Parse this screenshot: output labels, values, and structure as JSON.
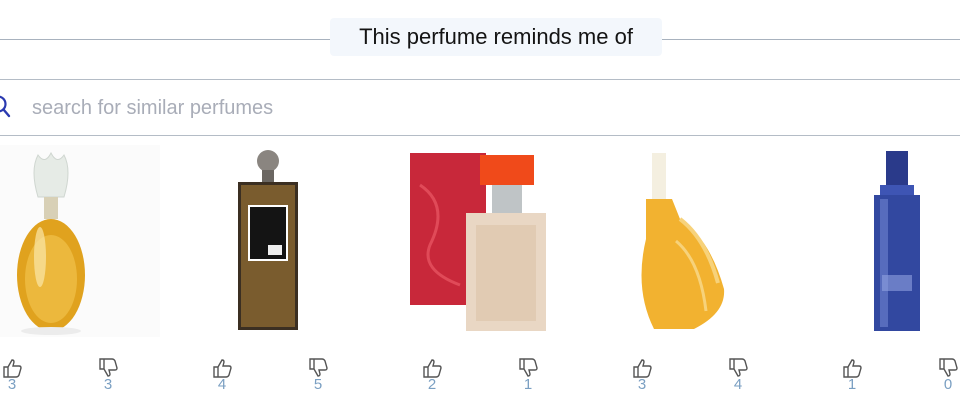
{
  "header": {
    "title": "This perfume reminds me of"
  },
  "search": {
    "placeholder": "search for similar perfumes",
    "value": ""
  },
  "colors": {
    "accent": "#2b3ab0",
    "count": "#7a9fc2",
    "divider": "#b4bcc6"
  },
  "perfumes": [
    {
      "image_icon": "perfume-bottle-floral",
      "upvotes": "3",
      "downvotes": "3"
    },
    {
      "image_icon": "perfume-bottle-black-label",
      "upvotes": "4",
      "downvotes": "5"
    },
    {
      "image_icon": "perfume-bottle-red-box",
      "upvotes": "2",
      "downvotes": "1"
    },
    {
      "image_icon": "perfume-bottle-shell",
      "upvotes": "3",
      "downvotes": "4"
    },
    {
      "image_icon": "perfume-bottle-blue",
      "upvotes": "1",
      "downvotes": "0"
    }
  ]
}
